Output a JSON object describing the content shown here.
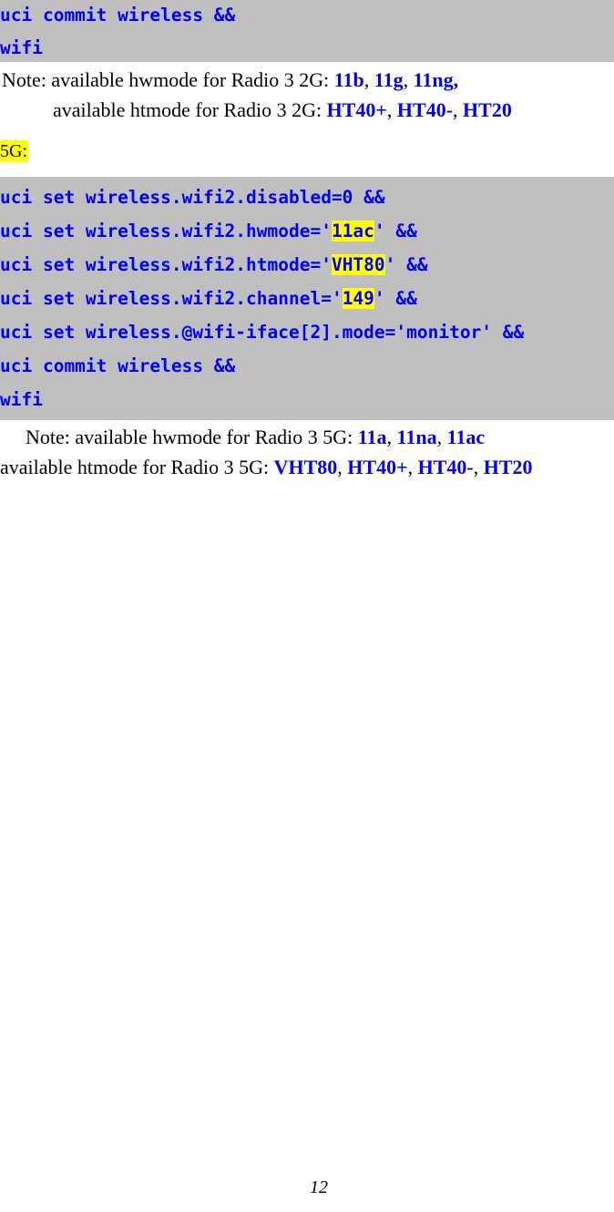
{
  "page": {
    "number": "12"
  },
  "code_block_top": {
    "lines": [
      [
        {
          "text": "uci commit wireless &&",
          "highlight": false
        }
      ],
      [
        {
          "text": "wifi",
          "highlight": false
        }
      ]
    ]
  },
  "notes_2g": {
    "line1_prefix": "Note: available hwmode for Radio 3 2G: ",
    "line1_values": [
      "11b",
      "11g",
      "11ng,"
    ],
    "line2_prefix": "available htmode for Radio 3 2G: ",
    "line2_values": [
      "HT40+",
      "HT40-",
      "HT20"
    ]
  },
  "section_label_5g": "5G:",
  "code_block_5g": {
    "lines": [
      [
        {
          "text": "uci set wireless.wifi2.disabled=0 &&",
          "highlight": false
        }
      ],
      [
        {
          "text": "uci set wireless.wifi2.hwmode='",
          "highlight": false
        },
        {
          "text": "11ac",
          "highlight": true
        },
        {
          "text": "' &&",
          "highlight": false
        }
      ],
      [
        {
          "text": "uci set wireless.wifi2.htmode='",
          "highlight": false
        },
        {
          "text": "VHT80",
          "highlight": true
        },
        {
          "text": "' &&",
          "highlight": false
        }
      ],
      [
        {
          "text": "uci set wireless.wifi2.channel='",
          "highlight": false
        },
        {
          "text": "149",
          "highlight": true
        },
        {
          "text": "' &&",
          "highlight": false
        }
      ],
      [
        {
          "text": "uci set wireless.@wifi-iface[2].mode='monitor' &&",
          "highlight": false
        }
      ],
      [
        {
          "text": "uci commit wireless &&",
          "highlight": false
        }
      ],
      [
        {
          "text": "wifi",
          "highlight": false
        }
      ]
    ]
  },
  "notes_5g": {
    "line1_prefix": "Note: available hwmode for Radio 3 5G: ",
    "line1_values": [
      "11a",
      "11na",
      "11ac"
    ],
    "line2_prefix": "available htmode for Radio 3 5G: ",
    "line2_values": [
      "VHT80",
      "HT40+",
      "HT40-",
      "HT20"
    ]
  },
  "colors": {
    "code_background": "#bfbfbf",
    "code_text": "#0000ff",
    "highlight": "#ffff00",
    "body_text": "#000000"
  }
}
